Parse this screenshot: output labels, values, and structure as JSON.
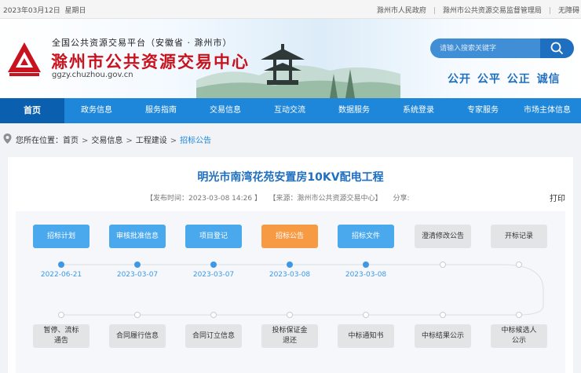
{
  "topbar": {
    "date": "2023年03月12日",
    "weekday": "星期日",
    "links": [
      "滁州市人民政府",
      "滁州市公共资源交易监督管理局",
      "无障碍"
    ]
  },
  "header": {
    "subtitle": "全国公共资源交易平台（安徽省 · 滁州市）",
    "title": "滁州市公共资源交易中心",
    "url": "ggzy.chuzhou.gov.cn",
    "search_placeholder": "请输入搜索关键字",
    "slogan": "公开 公平 公正 诚信"
  },
  "nav": {
    "items": [
      "首页",
      "政务信息",
      "服务指南",
      "交易信息",
      "互动交流",
      "数据服务",
      "系统登录",
      "专家服务",
      "市场主体信息"
    ],
    "active_index": 0
  },
  "breadcrumb": {
    "prefix": "您所在位置：",
    "items": [
      "首页",
      "交易信息",
      "工程建设",
      "招标公告"
    ]
  },
  "article": {
    "title": "明光市南湾花苑安置房10KV配电工程",
    "publish_time": "【发布时间：2023-03-08 14:26 】",
    "source": "【来源：滁州市公共资源交易中心】",
    "share": "分享:",
    "print": "打印"
  },
  "flow": {
    "top_steps": [
      {
        "label": "招标计划",
        "state": "done"
      },
      {
        "label": "审核批准信息",
        "state": "done"
      },
      {
        "label": "项目登记",
        "state": "done"
      },
      {
        "label": "招标公告",
        "state": "current"
      },
      {
        "label": "招标文件",
        "state": "done"
      },
      {
        "label": "澄清修改公告",
        "state": "pending"
      },
      {
        "label": "开标记录",
        "state": "pending"
      }
    ],
    "top_dates": [
      "2022-06-21",
      "2023-03-07",
      "2023-03-07",
      "2023-03-08",
      "2023-03-08",
      "",
      ""
    ],
    "bottom_steps": [
      {
        "label": "暂停、流标\n通告",
        "state": "pending"
      },
      {
        "label": "合同履行信息",
        "state": "pending"
      },
      {
        "label": "合同订立信息",
        "state": "pending"
      },
      {
        "label": "投标保证金\n退还",
        "state": "pending"
      },
      {
        "label": "中标通知书",
        "state": "pending"
      },
      {
        "label": "中标结果公示",
        "state": "pending"
      },
      {
        "label": "中标候选人\n公示",
        "state": "pending"
      }
    ]
  },
  "colors": {
    "nav": "#1f87d9",
    "nav_active": "#0a5fae",
    "brand_red": "#c8121d",
    "step_done": "#4aa8ec",
    "step_current": "#f79a44",
    "step_pending": "#e3e4e6"
  },
  "icons": [
    "logo-icon",
    "search-icon",
    "location-pin-icon"
  ]
}
